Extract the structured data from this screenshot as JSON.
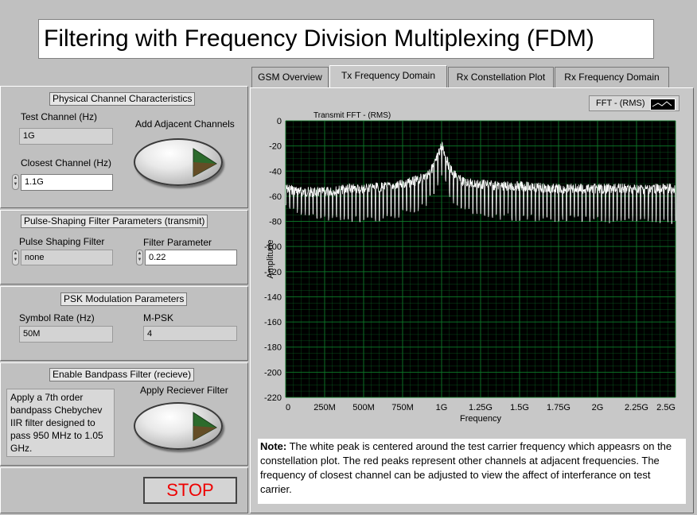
{
  "window": {
    "title": "Filtering with Frequency Division Multiplexing (FDM)"
  },
  "physical_channel": {
    "caption": "Physical Channel Characteristics",
    "test_channel_label": "Test Channel (Hz)",
    "test_channel_value": "1G",
    "closest_channel_label": "Closest Channel (Hz)",
    "closest_channel_value": "1.1G",
    "adjacent_label": "Add Adjacent Channels"
  },
  "pulse_shaping": {
    "caption": "Pulse-Shaping Filter Parameters (transmit)",
    "filter_label": "Pulse Shaping Filter",
    "filter_value": "none",
    "param_label": "Filter Parameter",
    "param_value": "0.22"
  },
  "psk": {
    "caption": "PSK Modulation Parameters",
    "symbol_rate_label": "Symbol Rate (Hz)",
    "symbol_rate_value": "50M",
    "mpsk_label": "M-PSK",
    "mpsk_value": "4"
  },
  "bandpass": {
    "caption": "Enable Bandpass Filter (recieve)",
    "description": "Apply a 7th order bandpass Chebychev IIR filter designed to pass 950 MHz to 1.05 GHz.",
    "apply_label": "Apply Reciever Filter"
  },
  "stop_label": "STOP",
  "tabs": [
    {
      "label": "GSM Overview",
      "active": false
    },
    {
      "label": "Tx Frequency Domain",
      "active": true
    },
    {
      "label": "Rx Constellation Plot",
      "active": false
    },
    {
      "label": "Rx Frequency Domain",
      "active": false
    }
  ],
  "legend": {
    "label": "FFT - (RMS)"
  },
  "note": {
    "bold": "Note:",
    "text": " The white peak is centered around the test carrier frequency which appeasrs on the constellation plot.  The red peaks represent other channels at adjacent frequencies.  The frequency of closest channel can be adjusted to view the affect of interferance on test carrier."
  },
  "colors": {
    "plot_bg": "#000000",
    "grid": "#0d7a2a",
    "trace": "#ffffff",
    "stop_text": "#ee0000",
    "knob_indicator": "#2c6b2c"
  },
  "chart_data": {
    "type": "line",
    "title": "Transmit FFT - (RMS)",
    "xlabel": "Frequency",
    "ylabel": "Amplitude",
    "xlim": [
      0,
      2500000000
    ],
    "ylim": [
      -220,
      0
    ],
    "x_tick_labels": [
      "0",
      "250M",
      "500M",
      "750M",
      "1G",
      "1.25G",
      "1.5G",
      "1.75G",
      "2G",
      "2.25G",
      "2.5G"
    ],
    "y_tick_labels": [
      "0",
      "-20",
      "-40",
      "-60",
      "-80",
      "-100",
      "-120",
      "-140",
      "-160",
      "-180",
      "-200",
      "-220"
    ],
    "grid": true,
    "legend_position": "top-right",
    "series": [
      {
        "name": "FFT - (RMS)",
        "color": "#ffffff",
        "x_mhz": [
          0,
          100,
          200,
          300,
          400,
          500,
          600,
          700,
          800,
          850,
          900,
          950,
          975,
          1000,
          1025,
          1050,
          1100,
          1150,
          1200,
          1300,
          1400,
          1500,
          1600,
          1700,
          1800,
          1900,
          2000,
          2100,
          2200,
          2300,
          2400,
          2500
        ],
        "upper_db": [
          -50,
          -52,
          -53,
          -52,
          -50,
          -50,
          -49,
          -48,
          -45,
          -43,
          -40,
          -32,
          -24,
          -15,
          -24,
          -33,
          -42,
          -45,
          -46,
          -47,
          -48,
          -48,
          -49,
          -50,
          -50,
          -50,
          -50,
          -50,
          -50,
          -50,
          -50,
          -50
        ],
        "lower_db": [
          -70,
          -75,
          -78,
          -80,
          -80,
          -82,
          -80,
          -78,
          -74,
          -72,
          -68,
          -60,
          -52,
          -45,
          -52,
          -62,
          -70,
          -73,
          -75,
          -78,
          -79,
          -80,
          -80,
          -81,
          -80,
          -81,
          -80,
          -82,
          -81,
          -80,
          -82,
          -82
        ]
      }
    ]
  }
}
